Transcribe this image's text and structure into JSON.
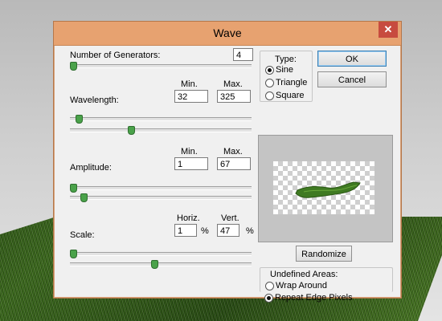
{
  "dialog": {
    "title": "Wave",
    "close_glyph": "✕",
    "generators": {
      "label": "Number of Generators:",
      "value": "4",
      "slider_fraction": 0.0
    },
    "wavelength": {
      "label": "Wavelength:",
      "min_header": "Min.",
      "max_header": "Max.",
      "min": "32",
      "max": "325",
      "min_fraction": 0.03,
      "max_fraction": 0.33
    },
    "amplitude": {
      "label": "Amplitude:",
      "min_header": "Min.",
      "max_header": "Max.",
      "min": "1",
      "max": "67",
      "min_fraction": 0.0,
      "max_fraction": 0.06
    },
    "scale": {
      "label": "Scale:",
      "horiz_header": "Horiz.",
      "vert_header": "Vert.",
      "horiz": "1",
      "vert": "47",
      "unit": "%",
      "horiz_fraction": 0.0,
      "vert_fraction": 0.46
    },
    "type": {
      "legend": "Type:",
      "options": [
        "Sine",
        "Triangle",
        "Square"
      ],
      "selected": "Sine"
    },
    "buttons": {
      "ok": "OK",
      "cancel": "Cancel",
      "randomize": "Randomize"
    },
    "undefined_areas": {
      "legend": "Undefined Areas:",
      "options": [
        "Wrap Around",
        "Repeat Edge Pixels"
      ],
      "selected": "Repeat Edge Pixels"
    }
  },
  "colors": {
    "titlebar": "#e7a270",
    "close_button": "#c74b3f",
    "slider_thumb": "#4aa24a"
  }
}
